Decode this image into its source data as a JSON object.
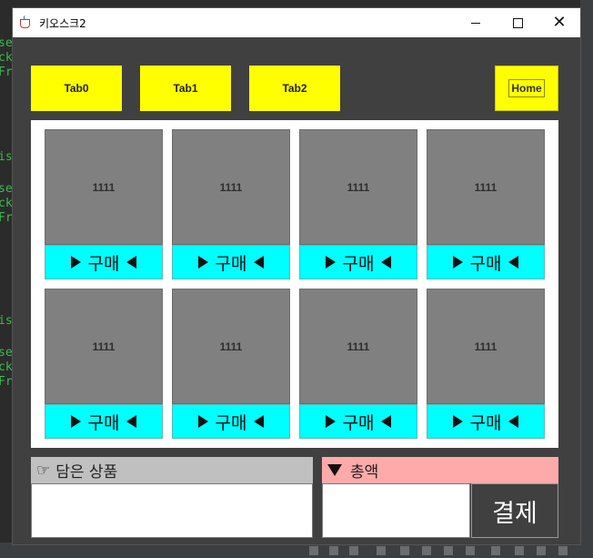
{
  "window": {
    "title": "키오스크2"
  },
  "tabs": [
    {
      "label": "Tab0"
    },
    {
      "label": "Tab1"
    },
    {
      "label": "Tab2"
    }
  ],
  "home": {
    "label": "Home"
  },
  "products": [
    {
      "name": "1111",
      "buy_label": "구매"
    },
    {
      "name": "1111",
      "buy_label": "구매"
    },
    {
      "name": "1111",
      "buy_label": "구매"
    },
    {
      "name": "1111",
      "buy_label": "구매"
    },
    {
      "name": "1111",
      "buy_label": "구매"
    },
    {
      "name": "1111",
      "buy_label": "구매"
    },
    {
      "name": "1111",
      "buy_label": "구매"
    },
    {
      "name": "1111",
      "buy_label": "구매"
    }
  ],
  "cart": {
    "title": "담은 상품",
    "icon": "pointing-hand-icon"
  },
  "total": {
    "title": "총액",
    "icon": "down-triangle-icon"
  },
  "pay": {
    "label": "결제"
  },
  "colors": {
    "tab": "#ffff00",
    "buy": "#00ffff",
    "product_image": "#808080",
    "cart_header": "#c0c0c0",
    "total_header": "#ffaaaa",
    "background": "#404040"
  }
}
